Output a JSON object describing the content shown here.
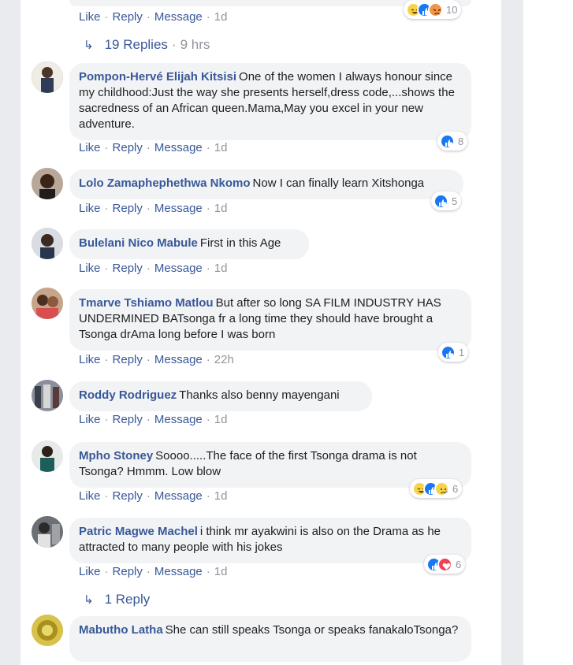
{
  "colors": {
    "link": "#385898",
    "meta": "#90949c",
    "bubble": "#f2f3f5",
    "like": "#1877f2"
  },
  "actions": {
    "like": "Like",
    "reply": "Reply",
    "message": "Message",
    "dot": "·"
  },
  "top_comment": {
    "time": "1d",
    "reaction_count": "10",
    "reaction_icons": [
      "haha-icon",
      "like-icon",
      "angry-icon"
    ]
  },
  "replies_link_1": {
    "label": "19 Replies",
    "time": "9 hrs"
  },
  "replies_link_2": {
    "label": "1 Reply"
  },
  "comments": [
    {
      "author": "Pompon-Hervé Elijah Kitsisi",
      "text": "One of the women I always honour since my childhood:Just the way she presents herself,dress code,...shows the sacredness of an African queen.Mama,May you excel in your new adventure.",
      "time": "1d",
      "reaction_count": "8",
      "reaction_icons": [
        "like-icon"
      ]
    },
    {
      "author": "Lolo Zamaphephethwa Nkomo",
      "text": "Now I can finally learn Xitshonga",
      "time": "1d",
      "reaction_count": "5",
      "reaction_icons": [
        "like-icon"
      ]
    },
    {
      "author": "Bulelani Nico Mabule",
      "text": "First in this Age",
      "time": "1d"
    },
    {
      "author": "Tmarve Tshiamo Matlou",
      "text": "But after so long SA FILM INDUSTRY HAS UNDERMINED BATsonga fr a long time they should have brought a Tsonga drAma long before I was born",
      "time": "22h",
      "reaction_count": "1",
      "reaction_icons": [
        "like-icon"
      ]
    },
    {
      "author": "Roddy Rodriguez",
      "text": "Thanks also benny mayengani",
      "time": "1d"
    },
    {
      "author": "Mpho Stoney",
      "text": "Soooo.....The face of the first Tsonga drama is not Tsonga? Hmmm. Low blow",
      "time": "1d",
      "reaction_count": "6",
      "reaction_icons": [
        "haha-icon",
        "like-icon",
        "sad-icon"
      ]
    },
    {
      "author": "Patric Magwe Machel",
      "text": "i think mr ayakwini is also on the Drama as he attracted to many people with his jokes",
      "time": "1d",
      "reaction_count": "6",
      "reaction_icons": [
        "like-icon",
        "love-icon"
      ]
    },
    {
      "author": "Mabutho Latha",
      "text": "She can still speaks Tsonga or speaks fanakaloTsonga?"
    }
  ]
}
